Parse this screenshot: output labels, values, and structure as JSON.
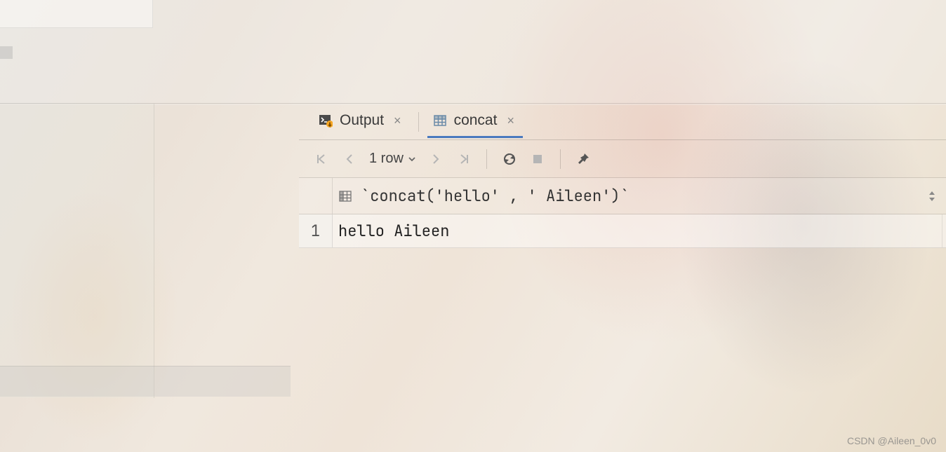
{
  "tabs": [
    {
      "label": "Output",
      "active": false
    },
    {
      "label": "concat",
      "active": true
    }
  ],
  "toolbar": {
    "row_count_label": "1 row"
  },
  "table": {
    "column_header": "`concat('hello' , ' Aileen')`",
    "rows": [
      {
        "num": "1",
        "value": "hello Aileen"
      }
    ]
  },
  "watermark": "CSDN @Aileen_0v0"
}
